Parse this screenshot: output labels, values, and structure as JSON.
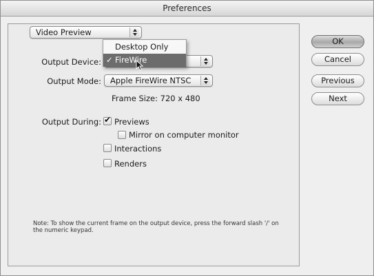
{
  "window": {
    "title": "Preferences"
  },
  "panel_selector": {
    "value": "Video Preview"
  },
  "output_device": {
    "label": "Output Device:",
    "menu": {
      "items": [
        {
          "label": "Desktop Only",
          "checked": false
        },
        {
          "label": "FireWire",
          "checked": true,
          "check_mark": "✓"
        }
      ]
    }
  },
  "output_mode": {
    "label": "Output Mode:",
    "value": "Apple FireWire NTSC"
  },
  "frame_size": "Frame Size: 720 x 480",
  "output_during": {
    "label": "Output During:",
    "options": [
      {
        "label": "Previews",
        "checked": true
      },
      {
        "label": "Mirror on computer monitor",
        "checked": false
      },
      {
        "label": "Interactions",
        "checked": false
      },
      {
        "label": "Renders",
        "checked": false
      }
    ]
  },
  "note": "Note:  To show the current frame on the output device, press the forward slash '/' on the numeric keypad.",
  "buttons": {
    "ok": "OK",
    "cancel": "Cancel",
    "previous": "Previous",
    "next": "Next"
  }
}
